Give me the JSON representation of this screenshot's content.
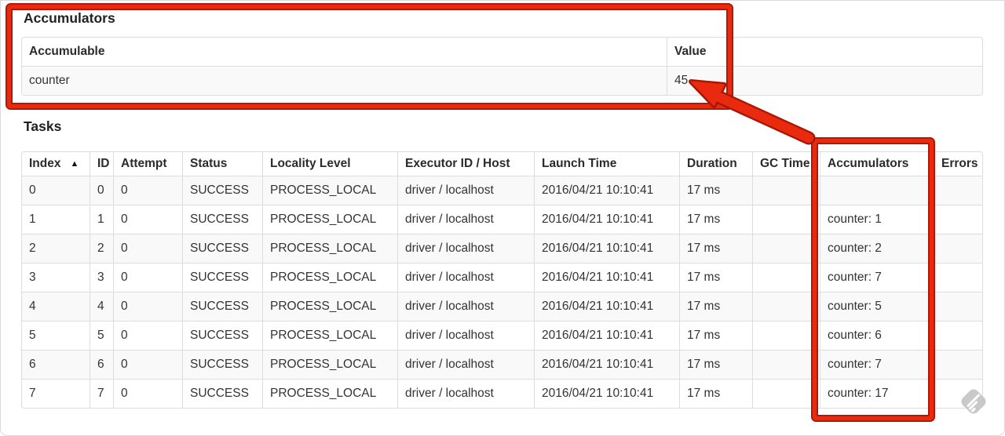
{
  "accumulators_section": {
    "title": "Accumulators",
    "columns": [
      "Accumulable",
      "Value"
    ],
    "rows": [
      [
        "counter",
        "45"
      ]
    ]
  },
  "tasks_section": {
    "title": "Tasks",
    "columns": [
      "Index",
      "ID",
      "Attempt",
      "Status",
      "Locality Level",
      "Executor ID / Host",
      "Launch Time",
      "Duration",
      "GC Time",
      "Accumulators",
      "Errors"
    ],
    "sort": {
      "column": "Index",
      "direction": "ascending",
      "icon": "▲"
    },
    "rows": [
      [
        "0",
        "0",
        "0",
        "SUCCESS",
        "PROCESS_LOCAL",
        "driver / localhost",
        "2016/04/21 10:10:41",
        "17 ms",
        "",
        "",
        ""
      ],
      [
        "1",
        "1",
        "0",
        "SUCCESS",
        "PROCESS_LOCAL",
        "driver / localhost",
        "2016/04/21 10:10:41",
        "17 ms",
        "",
        "counter: 1",
        ""
      ],
      [
        "2",
        "2",
        "0",
        "SUCCESS",
        "PROCESS_LOCAL",
        "driver / localhost",
        "2016/04/21 10:10:41",
        "17 ms",
        "",
        "counter: 2",
        ""
      ],
      [
        "3",
        "3",
        "0",
        "SUCCESS",
        "PROCESS_LOCAL",
        "driver / localhost",
        "2016/04/21 10:10:41",
        "17 ms",
        "",
        "counter: 7",
        ""
      ],
      [
        "4",
        "4",
        "0",
        "SUCCESS",
        "PROCESS_LOCAL",
        "driver / localhost",
        "2016/04/21 10:10:41",
        "17 ms",
        "",
        "counter: 5",
        ""
      ],
      [
        "5",
        "5",
        "0",
        "SUCCESS",
        "PROCESS_LOCAL",
        "driver / localhost",
        "2016/04/21 10:10:41",
        "17 ms",
        "",
        "counter: 6",
        ""
      ],
      [
        "6",
        "6",
        "0",
        "SUCCESS",
        "PROCESS_LOCAL",
        "driver / localhost",
        "2016/04/21 10:10:41",
        "17 ms",
        "",
        "counter: 7",
        ""
      ],
      [
        "7",
        "7",
        "0",
        "SUCCESS",
        "PROCESS_LOCAL",
        "driver / localhost",
        "2016/04/21 10:10:41",
        "17 ms",
        "",
        "counter: 17",
        ""
      ]
    ]
  },
  "annotations": {
    "highlight_color": "#ea2a0e",
    "highlight_outline_color": "#a81502",
    "box_1_target": "accumulators-summary-section",
    "box_2_target": "tasks-accumulators-column",
    "arrow_from": "tasks-accumulators-column",
    "arrow_to": "accumulator-value-45"
  },
  "watermark": {
    "icon": "annotation-app-watermark-icon",
    "color": "#c9c9c9"
  }
}
